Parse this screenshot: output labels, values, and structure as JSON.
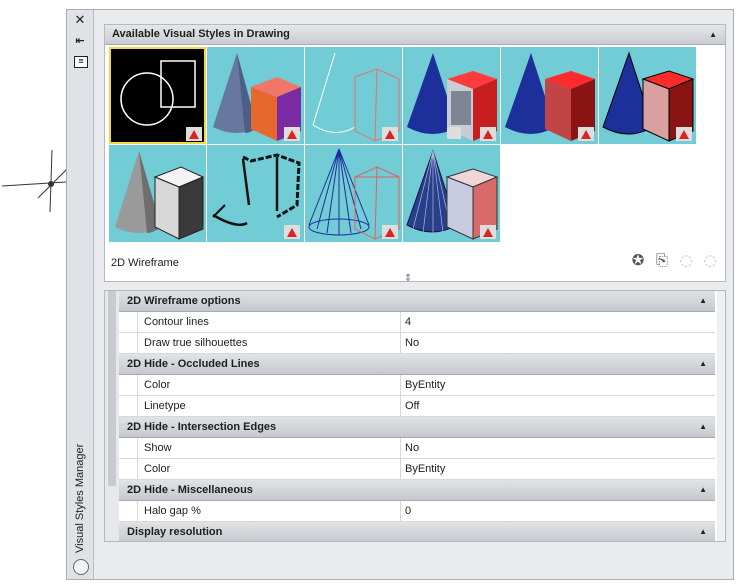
{
  "palette": {
    "vertical_title": "Visual Styles Manager",
    "close_glyph": "✕",
    "pin_glyph": "⇤",
    "menu_glyph": "≡"
  },
  "available": {
    "header": "Available Visual Styles in Drawing",
    "collapse_glyph": "▲",
    "current_name": "2D Wireframe",
    "thumb_count": 10
  },
  "tools": {
    "create_icon": "✪",
    "apply_icon": "⎘",
    "export_icon": "◌",
    "delete_icon": "◌"
  },
  "properties": {
    "categories": [
      {
        "title": "2D Wireframe options",
        "rows": [
          {
            "key": "Contour lines",
            "value": "4"
          },
          {
            "key": "Draw true silhouettes",
            "value": "No"
          }
        ]
      },
      {
        "title": "2D Hide - Occluded Lines",
        "rows": [
          {
            "key": "Color",
            "value": "ByEntity"
          },
          {
            "key": "Linetype",
            "value": "Off"
          }
        ]
      },
      {
        "title": "2D Hide - Intersection Edges",
        "rows": [
          {
            "key": "Show",
            "value": "No"
          },
          {
            "key": "Color",
            "value": "ByEntity"
          }
        ]
      },
      {
        "title": "2D Hide - Miscellaneous",
        "rows": [
          {
            "key": "Halo gap %",
            "value": "0"
          }
        ]
      },
      {
        "title": "Display resolution",
        "rows": []
      }
    ]
  },
  "colors": {
    "thumb_bg": "#71ccd5",
    "selected_outline": "#f3d640",
    "cube_red": "#e0282a",
    "cone_blue": "#1d2f9a"
  }
}
